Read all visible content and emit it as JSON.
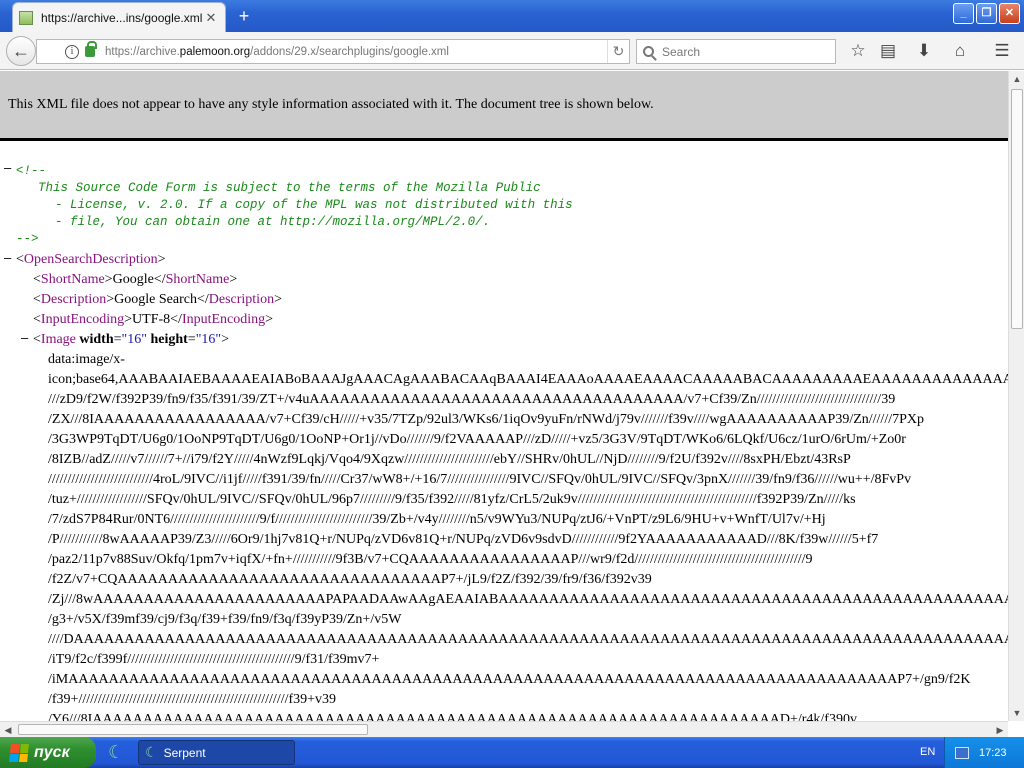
{
  "window": {
    "tab_title": "https://archive...ins/google.xml",
    "tab_close": "✕",
    "new_tab": "+",
    "btn_min": "_",
    "btn_max": "❐",
    "btn_close": "✕"
  },
  "nav": {
    "back": "←",
    "url_prefix": "https://archive.",
    "url_host": "palemoon.org",
    "url_path": "/addons/29.x/searchplugins/google.xml",
    "reload": "↻",
    "search_placeholder": "Search",
    "icons": [
      "star-icon",
      "reading-list-icon",
      "download-icon",
      "home-icon",
      "menu-icon"
    ]
  },
  "banner": "This XML file does not appear to have any style information associated with it. The document tree is shown below.",
  "tree": {
    "comment_open": "<!--",
    "comment_lines": [
      "This Source Code Form is subject to the terms of the Mozilla Public",
      "- License, v. 2.0. If a copy of the MPL was not distributed with this",
      "- file, You can obtain one at http://mozilla.org/MPL/2.0/."
    ],
    "comment_close": "-->",
    "root_tag": "OpenSearchDescription",
    "shortname_tag": "ShortName",
    "shortname_value": "Google",
    "description_tag": "Description",
    "description_value": "Google Search",
    "encoding_tag": "InputEncoding",
    "encoding_value": "UTF-8",
    "image_tag": "Image",
    "image_attr_width": "width",
    "image_width": "\"16\"",
    "image_attr_height": "height",
    "image_height": "\"16\"",
    "data_lines": [
      "data:image/x-",
      "icon;base64,AAABAAIAEBAAAAEAIABoBAAAJgAAACAgAAABACAAqBAAAI4EAAAoAAAAEAAAACAAAAABACAAAAAAAAAEAAAAAAAAAAAAAAAAAAAAAAAAAAAAA",
      "///zD9/f2W/f392P39/fn9/f35/f391/39/ZT+/v4uAAAAAAAAAAAAAAAAAAAAAAAAAAAAAAAAAAAAA/v7+Cf39/Zn////////////////////////////////39",
      "/ZX///8IAAAAAAAAAAAAAAAAA/v7+Cf39/cH/////+v35/7TZp/92ul3/WKs6/1iqOv9yuFn/rNWd/j79v///////f39v////wgAAAAAAAAAAP39/Zn//////7PXp",
      "/3G3WP9TqDT/U6g0/1OoNP9TqDT/U6g0/1OoNP+Or1j//vDo///////9/f2VAAAAAP///zD/////+vz5/3G3V/9TqDT/WKo6/6LQkf/U6cz/1urO/6rUm/+Zo0r",
      "/8IZB//adZ/////v7//////7+//i79/f2Y/////4nWzf9Lqkj/Vqo4/9Xqzw///////////////////////ebY//SHRv/0hUL//NjD////////9/f2U/f392v////8sxPH/Ebzt/43RsP",
      "///////////////////////////4roL/9IVC//i1jf/////f391/39/fn/////Cr37/wW8+/+16/7////////////////9IVC//SFQv/0hUL/9IVC//SFQv/3pnX///////39/fn9/f36//////wu++/8FvPv",
      "/tuz+//////////////////SFQv/0hUL/9IVC//SFQv/0hUL/96p7/////////9/f35/f392/////81yfz/CrL5/2uk9v//////////////////////////////////////////////f392P39/Zn/////ks",
      "/7/zdS7P84Rur/0NT6///////////////////////9/f/////////////////////////39/Zb+/v4y////////n5/v9WYu3/NUPq/ztJ6/+VnPT/z9L6/9HU+v+WnfT/Ul7v/+Hj",
      "/P///////////8wAAAAAP39/Z3/////6Or9/1hj7v81Q+r/NUPq/zVD6v81Q+r/NUPq/zVD6v9sdvD////////////9f2YAAAAAAAAAAAD///8K/f39w//////5+f7",
      "/paz2/11p7v88Suv/Okfq/1pm7v+iqfX/+fn+///////////9f3B/v7+CQAAAAAAAAAAAAAAAAP///wr9/f2d////////////////////////////////////////////9",
      "/f2Z/v7+CQAAAAAAAAAAAAAAAAAAAAAAAAAAAAAAAAP7+/jL9/f2Z/f392/39/fr9/f36/f392v39",
      "/Zj///8wAAAAAAAAAAAAAAAAAAAAAAAPAPAADAAwAAgAEAAIABAAAAAAAAAAAAAAAAAAAAAAAAAAAAAAAAAAAAAAAAAAAAAAAAAAAAAAAAAAAAAAAAAAAAAAAAAAAA",
      "/g3+/v5X/f39mf39/cj9/f3q/f39+f39/fn9/f3q/f39yP39/Zn+/v5W",
      "////DAAAAAAAAAAAAAAAAAAAAAAAAAAAAAAAAAAAAAAAAAAAAAAAAAAAAAAAAAAAAAAAAAAAAAAAAAAAAAAAAAAAAAAAAAAAAAAAAAAAAAAAAAAAAAAAAAAAAAAAAAAAAAAAAAA",
      "/iT9/f2c/f399f///////////////////////////////////////////9/f31/f39mv7+",
      "/iMAAAAAAAAAAAAAAAAAAAAAAAAAAAAAAAAAAAAAAAAAAAAAAAAAAAAAAAAAAAAAAAAAAAAAAAAAAAAAAAAAAP7+/gn9/f2K",
      "/f39+//////////////////////////////////////////////////////f39+v39",
      "/Y6///8IAAAAAAAAAAAAAAAAAAAAAAAAAAAAAAAAAAAAAAAAAAAAAAAAAAAAAAAAAAAAAAAAAAAAD+/r4k/f390v"
    ]
  },
  "taskbar": {
    "start": "пуск",
    "task": "Serpent",
    "lang": "EN",
    "clock": "17:23"
  }
}
